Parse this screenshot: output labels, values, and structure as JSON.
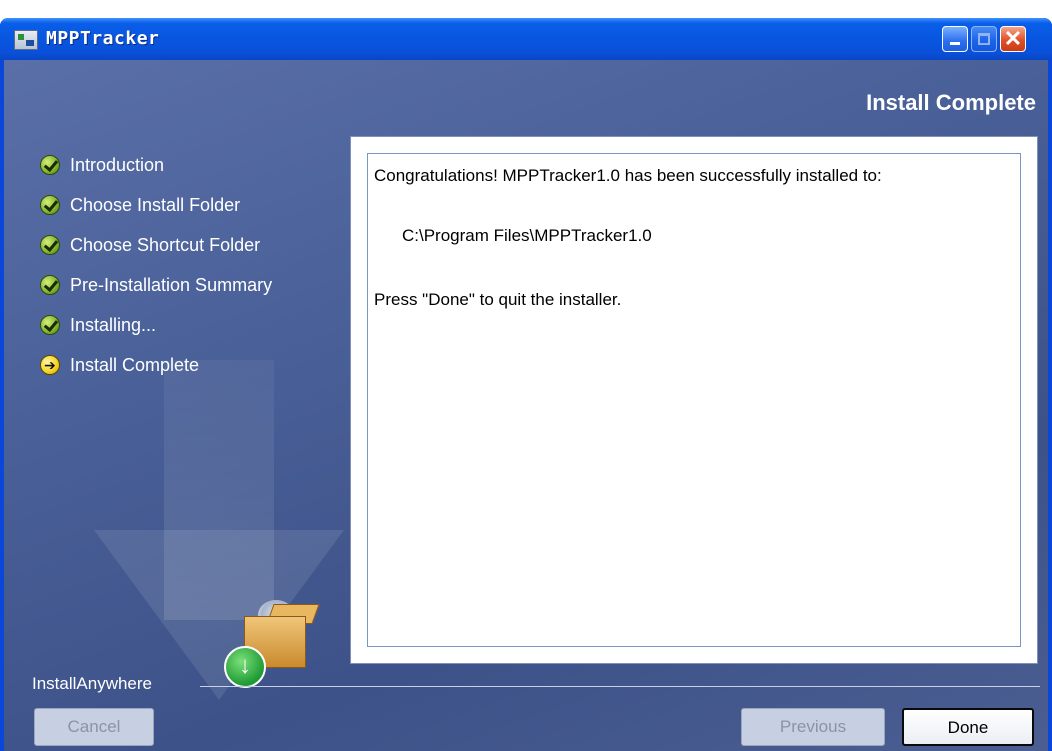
{
  "window": {
    "title": "MPPTracker",
    "minimize_icon": "minimize-icon",
    "maximize_icon": "maximize-icon",
    "close_icon": "close-icon"
  },
  "header": {
    "step_title": "Install Complete"
  },
  "steps": [
    {
      "label": "Introduction",
      "status": "done"
    },
    {
      "label": "Choose Install Folder",
      "status": "done"
    },
    {
      "label": "Choose Shortcut Folder",
      "status": "done"
    },
    {
      "label": "Pre-Installation Summary",
      "status": "done"
    },
    {
      "label": "Installing...",
      "status": "done"
    },
    {
      "label": "Install Complete",
      "status": "current"
    }
  ],
  "content": {
    "line1": "Congratulations! MPPTracker1.0 has been successfully installed to:",
    "install_path": "C:\\Program Files\\MPPTracker1.0",
    "line3": "Press \"Done\" to quit the installer."
  },
  "footer": {
    "brand": "InstallAnywhere",
    "cancel_label": "Cancel",
    "previous_label": "Previous",
    "done_label": "Done"
  },
  "colors": {
    "titlebar": "#0856e0",
    "client_bg": "#4a6098",
    "close_button": "#e0502a"
  }
}
